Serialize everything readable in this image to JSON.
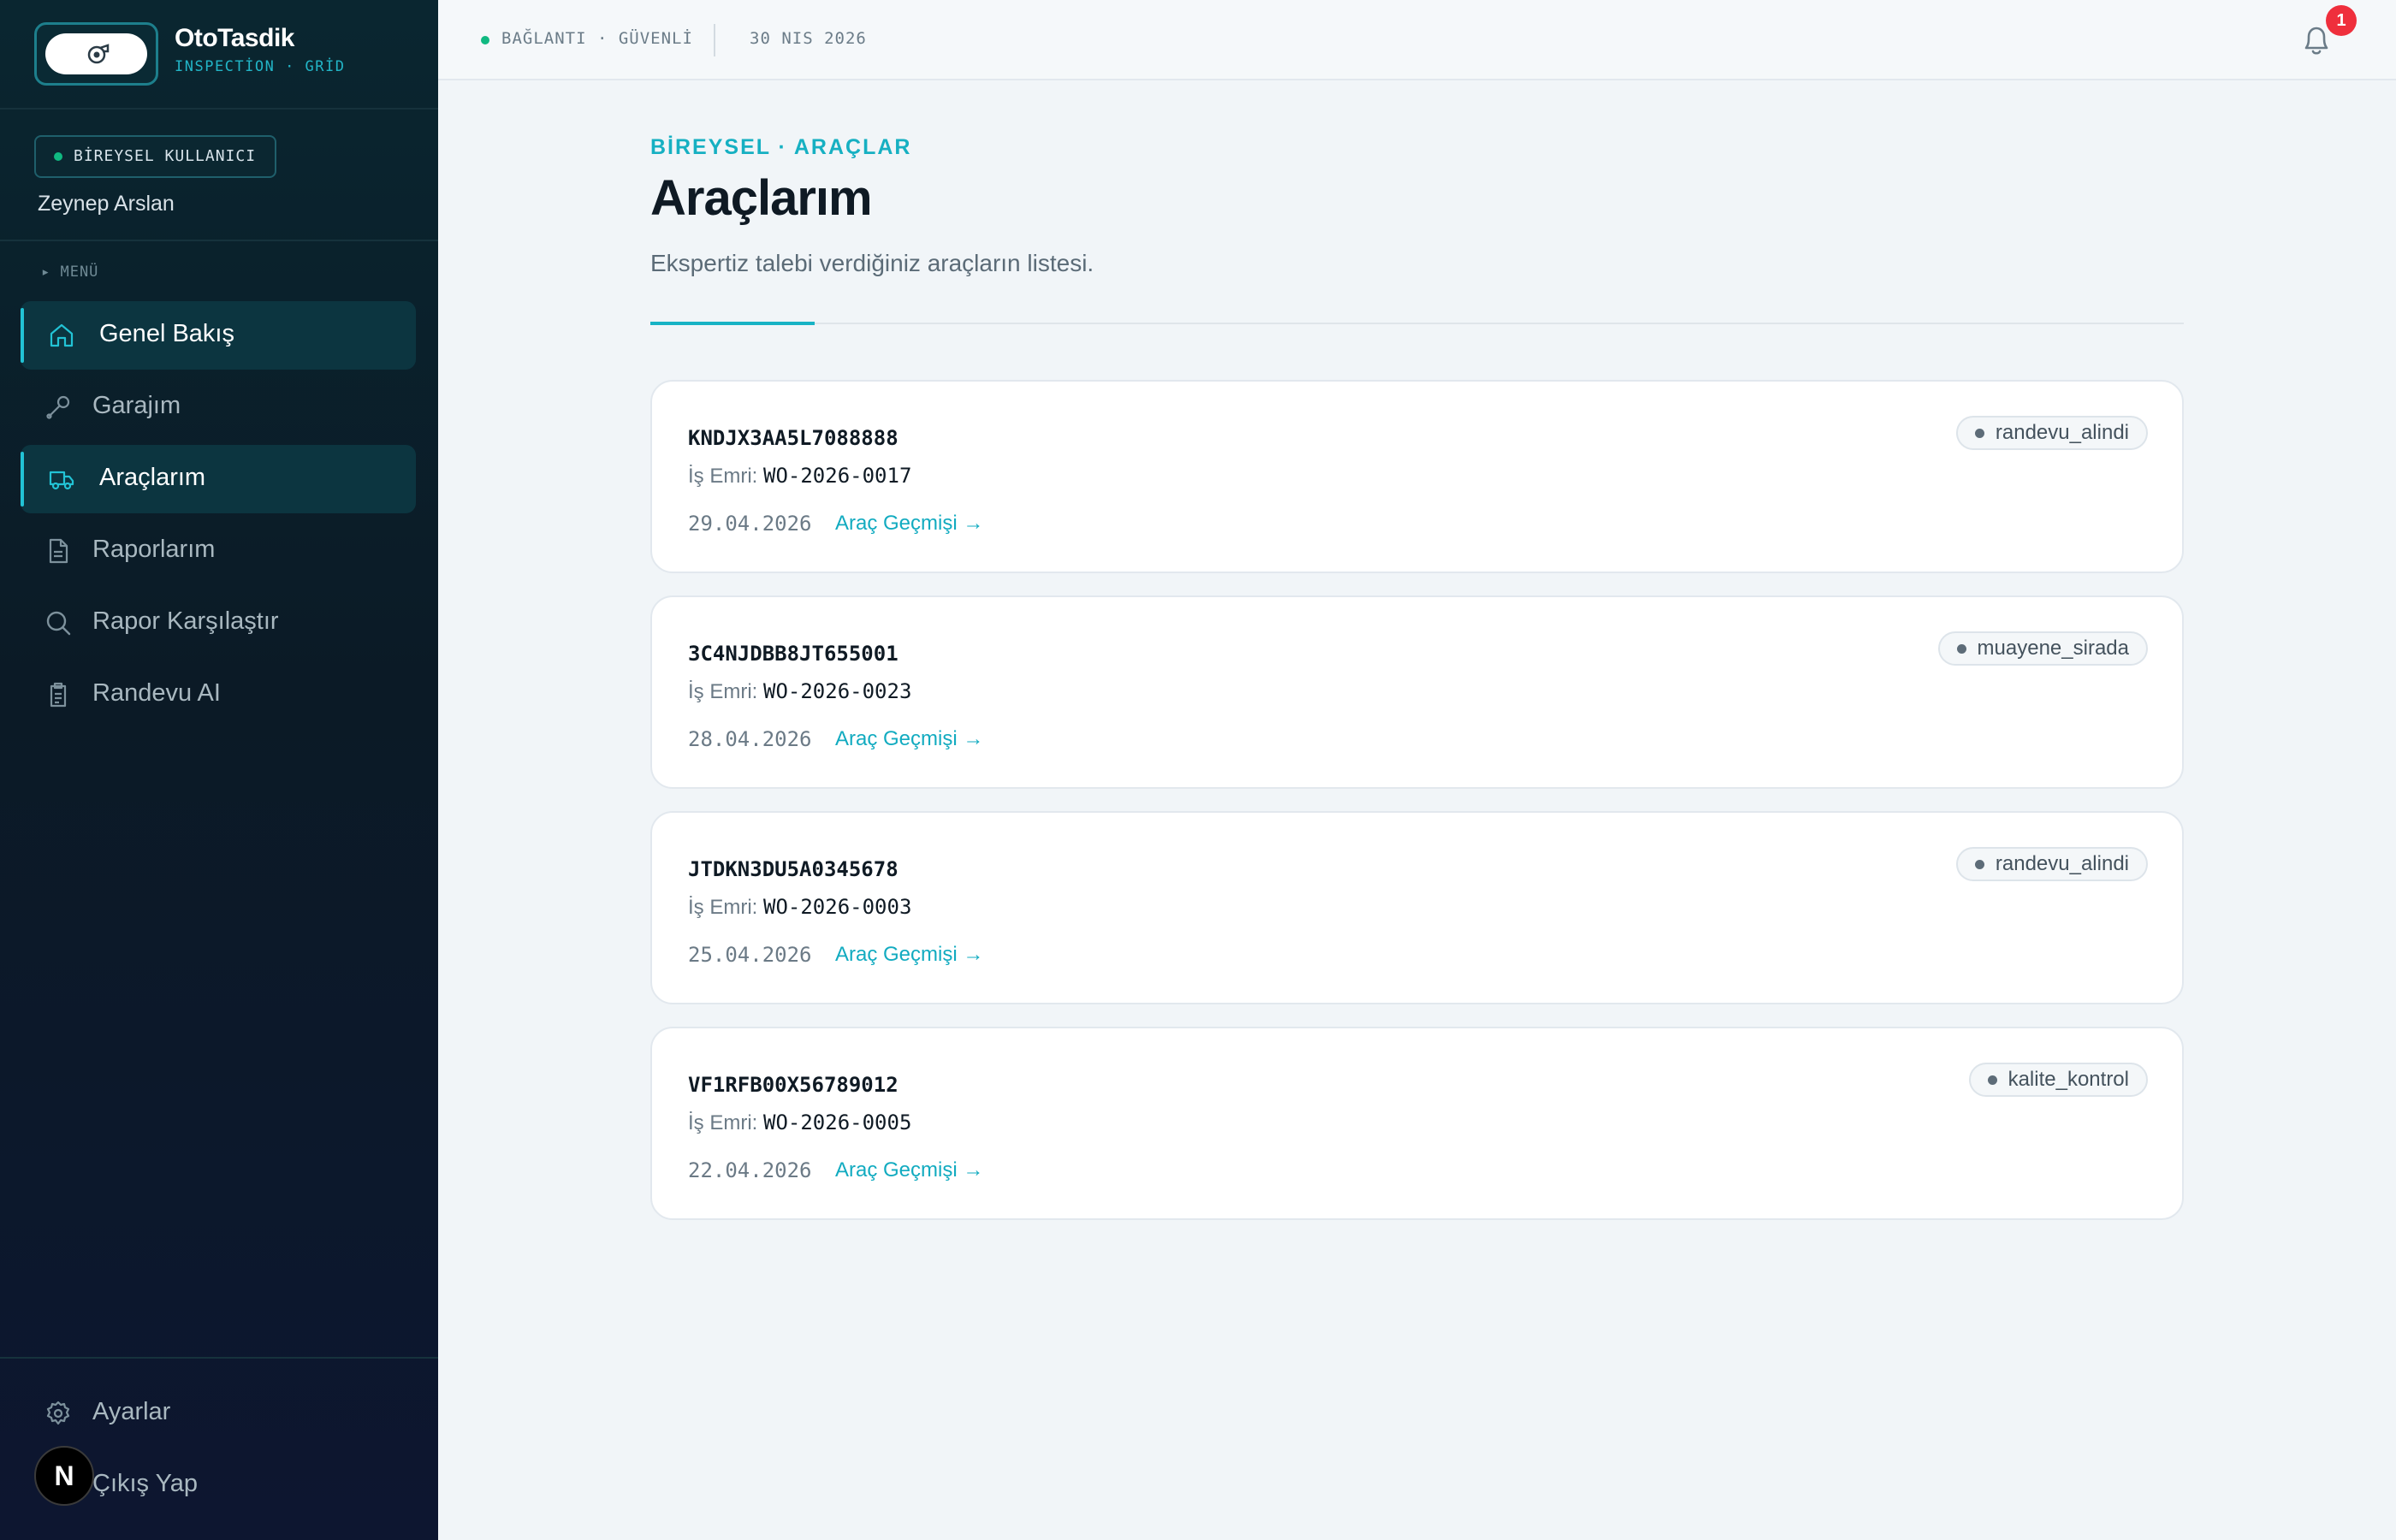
{
  "brand": {
    "name": "OtoTasdik",
    "subtitle": "INSPECTİON · GRİD"
  },
  "user": {
    "role": "BİREYSEL KULLANICI",
    "name": "Zeynep Arslan"
  },
  "menu": {
    "label": "▸ MENÜ",
    "items": [
      {
        "label": "Genel Bakış",
        "icon": "home-icon",
        "active": true
      },
      {
        "label": "Garajım",
        "icon": "wrench-icon",
        "active": false
      },
      {
        "label": "Araçlarım",
        "icon": "truck-icon",
        "active": true
      },
      {
        "label": "Raporlarım",
        "icon": "document-icon",
        "active": false
      },
      {
        "label": "Rapor Karşılaştır",
        "icon": "search-icon",
        "active": false
      },
      {
        "label": "Randevu AI",
        "icon": "clipboard-icon",
        "active": false
      }
    ],
    "bottom": [
      {
        "label": "Ayarlar",
        "icon": "gear-icon"
      },
      {
        "label": "Çıkış Yap",
        "icon": "logout-icon"
      }
    ]
  },
  "topbar": {
    "connection": "BAĞLANTI · GÜVENLİ",
    "date": "30 NIS 2026",
    "notification_count": "1",
    "n_badge": "N"
  },
  "page": {
    "breadcrumb": "BİREYSEL · ARAÇLAR",
    "title": "Araçlarım",
    "description": "Ekspertiz talebi verdiğiniz araçların listesi."
  },
  "vehicles": [
    {
      "vin": "KNDJX3AA5L7088888",
      "wo_label": "İş Emri:",
      "wo": "WO-2026-0017",
      "date": "29.04.2026",
      "history": "Araç Geçmişi →",
      "status": "randevu_alindi"
    },
    {
      "vin": "3C4NJDBB8JT655001",
      "wo_label": "İş Emri:",
      "wo": "WO-2026-0023",
      "date": "28.04.2026",
      "history": "Araç Geçmişi →",
      "status": "muayene_sirada"
    },
    {
      "vin": "JTDKN3DU5A0345678",
      "wo_label": "İş Emri:",
      "wo": "WO-2026-0003",
      "date": "25.04.2026",
      "history": "Araç Geçmişi →",
      "status": "randevu_alindi"
    },
    {
      "vin": "VF1RFB00X56789012",
      "wo_label": "İş Emri:",
      "wo": "WO-2026-0005",
      "date": "22.04.2026",
      "history": "Araç Geçmişi →",
      "status": "kalite_kontrol"
    }
  ],
  "colors": {
    "accent": "#16b0c2",
    "sidebar": "#0b1a26",
    "status_online": "#10b981",
    "badge": "#ef2f3c"
  }
}
